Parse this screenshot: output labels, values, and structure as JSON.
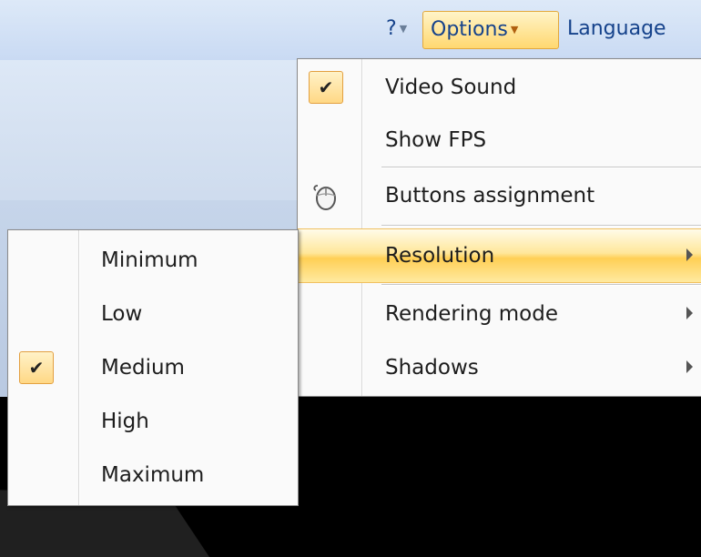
{
  "menubar": {
    "help": {
      "label": "?",
      "icon": "dropdown-arrow-icon"
    },
    "options": {
      "label": "Options",
      "icon": "dropdown-arrow-icon"
    },
    "language": {
      "label": "Language"
    }
  },
  "options_menu": {
    "items": [
      {
        "label": "Video Sound",
        "checked": true
      },
      {
        "label": "Show FPS",
        "checked": false
      },
      {
        "label": "Buttons assignment",
        "icon": "mouse-icon"
      },
      {
        "label": "Resolution",
        "submenu": true,
        "highlighted": true
      },
      {
        "label": "Rendering mode",
        "submenu": true
      },
      {
        "label": "Shadows",
        "submenu": true
      }
    ]
  },
  "resolution_menu": {
    "items": [
      {
        "label": "Minimum",
        "checked": false
      },
      {
        "label": "Low",
        "checked": false
      },
      {
        "label": "Medium",
        "checked": true
      },
      {
        "label": "High",
        "checked": false
      },
      {
        "label": "Maximum",
        "checked": false
      }
    ]
  },
  "colors": {
    "highlight": "#ffd870",
    "menubar_text": "#15428b",
    "check_bg": "#ffe0a0"
  }
}
